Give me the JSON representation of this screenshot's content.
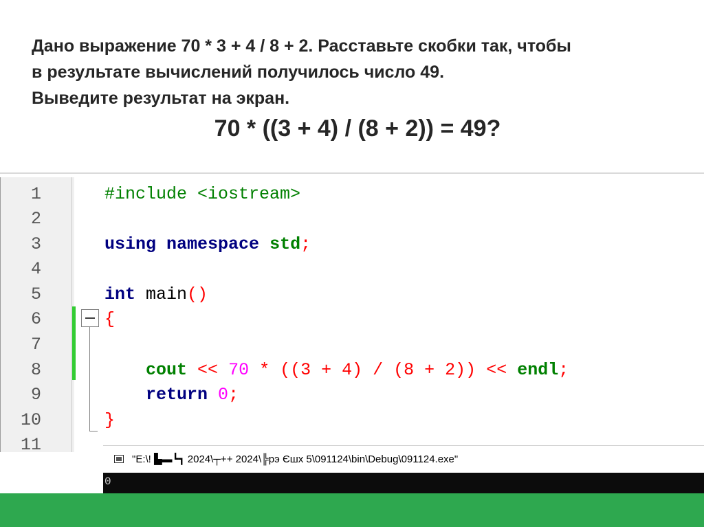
{
  "slide": {
    "task_lines": [
      "Дано выражение 70 * 3 + 4 / 8 + 2. Расставьте скобки так, чтобы",
      "в результате вычислений получилось число 49.",
      "Выведите результат на экран."
    ],
    "formula": "70 * ((3 + 4) / (8 + 2)) = 49?"
  },
  "editor": {
    "line_numbers": [
      "1",
      "2",
      "3",
      "4",
      "5",
      "6",
      "7",
      "8",
      "9",
      "10",
      "11"
    ],
    "code": {
      "l1_pre": "#include <iostream>",
      "l3_kw1": "using",
      "l3_kw2": "namespace",
      "l3_id": "std",
      "l3_semi": ";",
      "l5_kw": "int",
      "l5_fn": "main",
      "l5_parens": "()",
      "l6_brace": "{",
      "l8_cout": "cout",
      "l8_op1": "<<",
      "l8_num70": "70",
      "l8_expr": "* ((3 + 4) / (8 + 2))",
      "l8_op2": "<<",
      "l8_endl": "endl",
      "l8_semi": ";",
      "l9_kw": "return",
      "l9_num": "0",
      "l9_semi": ";",
      "l10_brace": "}"
    }
  },
  "console": {
    "title": "\"E:\\! ▙▬┗┓ 2024\\┬++ 2024\\╠рэ Єшх 5\\091124\\bin\\Debug\\091124.exe\"",
    "output": "0"
  },
  "colors": {
    "footer": "#2ea84f",
    "change_bar": "#33cc33",
    "keyword": "#000080",
    "number": "#ff00ff",
    "operator": "#ff0000"
  }
}
